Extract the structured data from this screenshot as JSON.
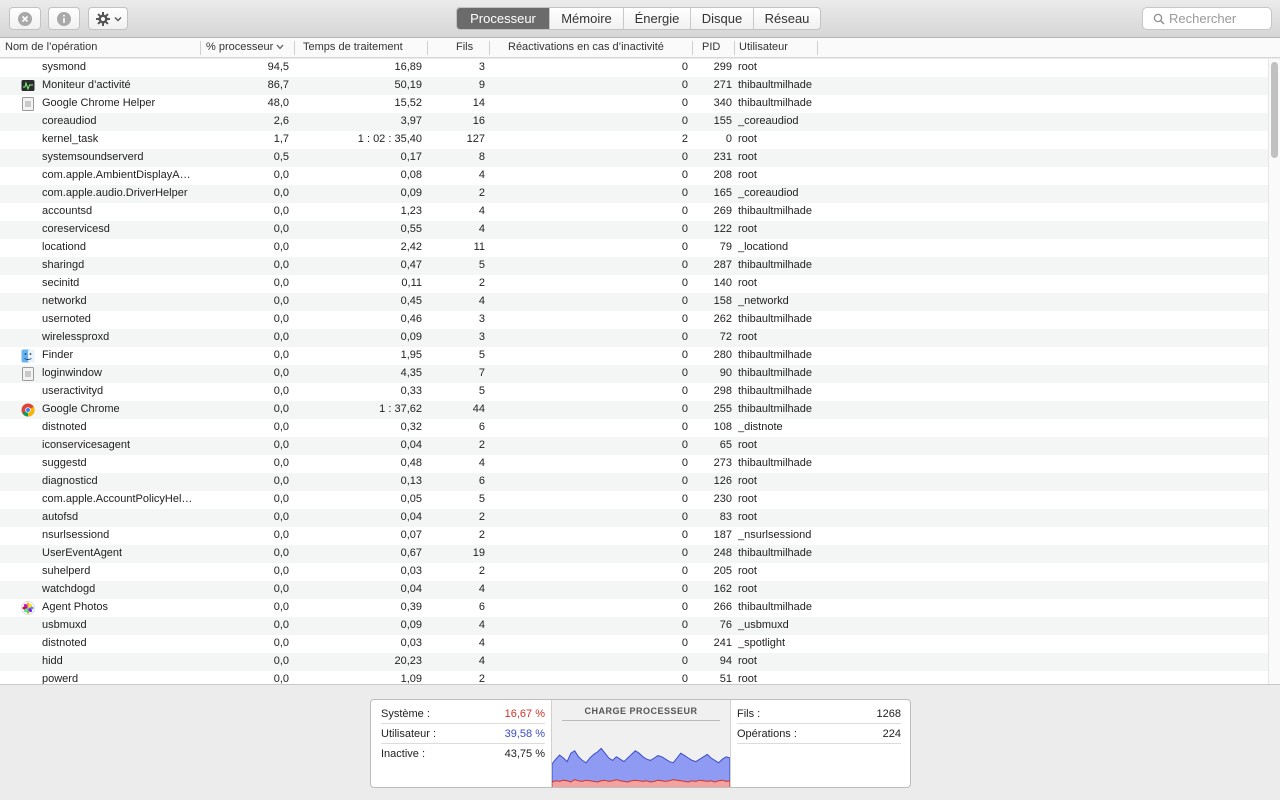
{
  "toolbar": {
    "tabs": [
      "Processeur",
      "Mémoire",
      "Énergie",
      "Disque",
      "Réseau"
    ],
    "active_tab": "Processeur",
    "search_placeholder": "Rechercher"
  },
  "columns": {
    "name": "Nom de l’opération",
    "cpu": "% processeur",
    "time": "Temps de traitement",
    "threads": "Fils",
    "wakeups": "Réactivations en cas d’inactivité",
    "pid": "PID",
    "user": "Utilisateur"
  },
  "processes": [
    {
      "name": "sysmond",
      "cpu": "94,5",
      "time": "16,89",
      "threads": "3",
      "wakeups": "0",
      "pid": "299",
      "user": "root",
      "icon": "none"
    },
    {
      "name": "Moniteur d’activité",
      "cpu": "86,7",
      "time": "50,19",
      "threads": "9",
      "wakeups": "0",
      "pid": "271",
      "user": "thibaultmilhade",
      "icon": "activity-monitor-icon"
    },
    {
      "name": "Google Chrome Helper",
      "cpu": "48,0",
      "time": "15,52",
      "threads": "14",
      "wakeups": "0",
      "pid": "340",
      "user": "thibaultmilhade",
      "icon": "generic-app-icon"
    },
    {
      "name": "coreaudiod",
      "cpu": "2,6",
      "time": "3,97",
      "threads": "16",
      "wakeups": "0",
      "pid": "155",
      "user": "_coreaudiod",
      "icon": "none"
    },
    {
      "name": "kernel_task",
      "cpu": "1,7",
      "time": "1 : 02 : 35,40",
      "threads": "127",
      "wakeups": "2",
      "pid": "0",
      "user": "root",
      "icon": "none"
    },
    {
      "name": "systemsoundserverd",
      "cpu": "0,5",
      "time": "0,17",
      "threads": "8",
      "wakeups": "0",
      "pid": "231",
      "user": "root",
      "icon": "none"
    },
    {
      "name": "com.apple.AmbientDisplayA…",
      "cpu": "0,0",
      "time": "0,08",
      "threads": "4",
      "wakeups": "0",
      "pid": "208",
      "user": "root",
      "icon": "none"
    },
    {
      "name": "com.apple.audio.DriverHelper",
      "cpu": "0,0",
      "time": "0,09",
      "threads": "2",
      "wakeups": "0",
      "pid": "165",
      "user": "_coreaudiod",
      "icon": "none"
    },
    {
      "name": "accountsd",
      "cpu": "0,0",
      "time": "1,23",
      "threads": "4",
      "wakeups": "0",
      "pid": "269",
      "user": "thibaultmilhade",
      "icon": "none"
    },
    {
      "name": "coreservicesd",
      "cpu": "0,0",
      "time": "0,55",
      "threads": "4",
      "wakeups": "0",
      "pid": "122",
      "user": "root",
      "icon": "none"
    },
    {
      "name": "locationd",
      "cpu": "0,0",
      "time": "2,42",
      "threads": "11",
      "wakeups": "0",
      "pid": "79",
      "user": "_locationd",
      "icon": "none"
    },
    {
      "name": "sharingd",
      "cpu": "0,0",
      "time": "0,47",
      "threads": "5",
      "wakeups": "0",
      "pid": "287",
      "user": "thibaultmilhade",
      "icon": "none"
    },
    {
      "name": "secinitd",
      "cpu": "0,0",
      "time": "0,11",
      "threads": "2",
      "wakeups": "0",
      "pid": "140",
      "user": "root",
      "icon": "none"
    },
    {
      "name": "networkd",
      "cpu": "0,0",
      "time": "0,45",
      "threads": "4",
      "wakeups": "0",
      "pid": "158",
      "user": "_networkd",
      "icon": "none"
    },
    {
      "name": "usernoted",
      "cpu": "0,0",
      "time": "0,46",
      "threads": "3",
      "wakeups": "0",
      "pid": "262",
      "user": "thibaultmilhade",
      "icon": "none"
    },
    {
      "name": "wirelessproxd",
      "cpu": "0,0",
      "time": "0,09",
      "threads": "3",
      "wakeups": "0",
      "pid": "72",
      "user": "root",
      "icon": "none"
    },
    {
      "name": "Finder",
      "cpu": "0,0",
      "time": "1,95",
      "threads": "5",
      "wakeups": "0",
      "pid": "280",
      "user": "thibaultmilhade",
      "icon": "finder-icon"
    },
    {
      "name": "loginwindow",
      "cpu": "0,0",
      "time": "4,35",
      "threads": "7",
      "wakeups": "0",
      "pid": "90",
      "user": "thibaultmilhade",
      "icon": "generic-app-icon"
    },
    {
      "name": "useractivityd",
      "cpu": "0,0",
      "time": "0,33",
      "threads": "5",
      "wakeups": "0",
      "pid": "298",
      "user": "thibaultmilhade",
      "icon": "none"
    },
    {
      "name": "Google Chrome",
      "cpu": "0,0",
      "time": "1 : 37,62",
      "threads": "44",
      "wakeups": "0",
      "pid": "255",
      "user": "thibaultmilhade",
      "icon": "chrome-icon"
    },
    {
      "name": "distnoted",
      "cpu": "0,0",
      "time": "0,32",
      "threads": "6",
      "wakeups": "0",
      "pid": "108",
      "user": "_distnote",
      "icon": "none"
    },
    {
      "name": "iconservicesagent",
      "cpu": "0,0",
      "time": "0,04",
      "threads": "2",
      "wakeups": "0",
      "pid": "65",
      "user": "root",
      "icon": "none"
    },
    {
      "name": "suggestd",
      "cpu": "0,0",
      "time": "0,48",
      "threads": "4",
      "wakeups": "0",
      "pid": "273",
      "user": "thibaultmilhade",
      "icon": "none"
    },
    {
      "name": "diagnosticd",
      "cpu": "0,0",
      "time": "0,13",
      "threads": "6",
      "wakeups": "0",
      "pid": "126",
      "user": "root",
      "icon": "none"
    },
    {
      "name": "com.apple.AccountPolicyHel…",
      "cpu": "0,0",
      "time": "0,05",
      "threads": "5",
      "wakeups": "0",
      "pid": "230",
      "user": "root",
      "icon": "none"
    },
    {
      "name": "autofsd",
      "cpu": "0,0",
      "time": "0,04",
      "threads": "2",
      "wakeups": "0",
      "pid": "83",
      "user": "root",
      "icon": "none"
    },
    {
      "name": "nsurlsessiond",
      "cpu": "0,0",
      "time": "0,07",
      "threads": "2",
      "wakeups": "0",
      "pid": "187",
      "user": "_nsurlsessiond",
      "icon": "none"
    },
    {
      "name": "UserEventAgent",
      "cpu": "0,0",
      "time": "0,67",
      "threads": "19",
      "wakeups": "0",
      "pid": "248",
      "user": "thibaultmilhade",
      "icon": "none"
    },
    {
      "name": "suhelperd",
      "cpu": "0,0",
      "time": "0,03",
      "threads": "2",
      "wakeups": "0",
      "pid": "205",
      "user": "root",
      "icon": "none"
    },
    {
      "name": "watchdogd",
      "cpu": "0,0",
      "time": "0,04",
      "threads": "4",
      "wakeups": "0",
      "pid": "162",
      "user": "root",
      "icon": "none"
    },
    {
      "name": "Agent Photos",
      "cpu": "0,0",
      "time": "0,39",
      "threads": "6",
      "wakeups": "0",
      "pid": "266",
      "user": "thibaultmilhade",
      "icon": "photos-icon"
    },
    {
      "name": "usbmuxd",
      "cpu": "0,0",
      "time": "0,09",
      "threads": "4",
      "wakeups": "0",
      "pid": "76",
      "user": "_usbmuxd",
      "icon": "none"
    },
    {
      "name": "distnoted",
      "cpu": "0,0",
      "time": "0,03",
      "threads": "4",
      "wakeups": "0",
      "pid": "241",
      "user": "_spotlight",
      "icon": "none"
    },
    {
      "name": "hidd",
      "cpu": "0,0",
      "time": "20,23",
      "threads": "4",
      "wakeups": "0",
      "pid": "94",
      "user": "root",
      "icon": "none"
    },
    {
      "name": "powerd",
      "cpu": "0,0",
      "time": "1,09",
      "threads": "2",
      "wakeups": "0",
      "pid": "51",
      "user": "root",
      "icon": "none"
    }
  ],
  "summary": {
    "system_label": "Système :",
    "system_value": "16,67 %",
    "user_label": "Utilisateur :",
    "user_value": "39,58 %",
    "idle_label": "Inactive :",
    "idle_value": "43,75 %",
    "chart_title": "CHARGE PROCESSEUR",
    "threads_label": "Fils :",
    "threads_value": "1268",
    "operations_label": "Opérations :",
    "operations_value": "224",
    "system_color": "#d0342c",
    "user_color": "#3b4dc8"
  },
  "cpu_load_history": {
    "system": [
      10,
      12,
      11,
      13,
      12,
      10,
      14,
      12,
      11,
      13,
      12,
      11,
      10,
      12,
      13,
      11,
      12,
      14,
      12,
      11,
      10,
      12,
      13,
      12,
      11,
      12,
      10,
      11,
      13,
      12,
      11,
      12,
      14,
      13,
      12,
      11,
      10,
      12,
      11,
      13,
      12,
      11,
      12,
      10,
      12,
      13,
      11,
      12
    ],
    "total": [
      40,
      48,
      55,
      50,
      44,
      58,
      62,
      52,
      46,
      42,
      50,
      56,
      60,
      66,
      58,
      50,
      46,
      52,
      48,
      44,
      50,
      56,
      62,
      58,
      52,
      48,
      46,
      50,
      54,
      52,
      48,
      44,
      42,
      50,
      58,
      54,
      50,
      46,
      44,
      48,
      52,
      56,
      50,
      46,
      42,
      48,
      52,
      50
    ]
  }
}
